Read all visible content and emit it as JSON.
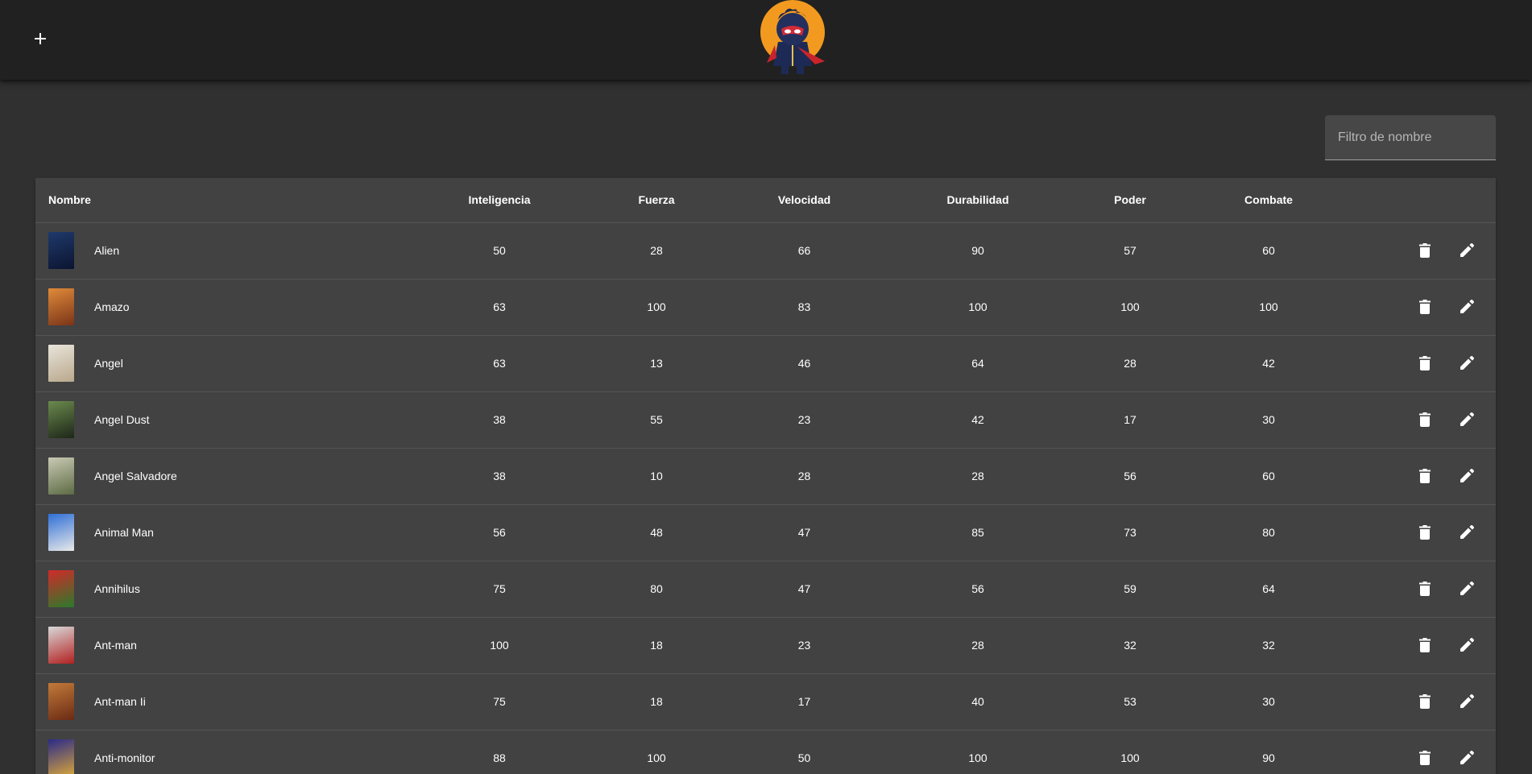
{
  "toolbar": {
    "add_icon": "plus-icon",
    "logo_icon": "superhero-mascot-logo"
  },
  "filter": {
    "placeholder": "Filtro de nombre",
    "value": ""
  },
  "table": {
    "headers": {
      "name": "Nombre",
      "intelligence": "Inteligencia",
      "strength": "Fuerza",
      "speed": "Velocidad",
      "durability": "Durabilidad",
      "power": "Poder",
      "combat": "Combate"
    },
    "row_actions": {
      "delete_icon": "trash-icon",
      "edit_icon": "pencil-icon"
    },
    "rows": [
      {
        "name": "Alien",
        "intelligence": "50",
        "strength": "28",
        "speed": "66",
        "durability": "90",
        "power": "57",
        "combat": "60",
        "thumb_colors": [
          "#1f3a6b",
          "#0b1430"
        ]
      },
      {
        "name": "Amazo",
        "intelligence": "63",
        "strength": "100",
        "speed": "83",
        "durability": "100",
        "power": "100",
        "combat": "100",
        "thumb_colors": [
          "#e08a3a",
          "#7a3418"
        ]
      },
      {
        "name": "Angel",
        "intelligence": "63",
        "strength": "13",
        "speed": "46",
        "durability": "64",
        "power": "28",
        "combat": "42",
        "thumb_colors": [
          "#e8e4da",
          "#b9a88c"
        ]
      },
      {
        "name": "Angel Dust",
        "intelligence": "38",
        "strength": "55",
        "speed": "23",
        "durability": "42",
        "power": "17",
        "combat": "30",
        "thumb_colors": [
          "#6b8a4e",
          "#1d2618"
        ]
      },
      {
        "name": "Angel Salvadore",
        "intelligence": "38",
        "strength": "10",
        "speed": "28",
        "durability": "28",
        "power": "56",
        "combat": "60",
        "thumb_colors": [
          "#c9c9b4",
          "#5d6b44"
        ]
      },
      {
        "name": "Animal Man",
        "intelligence": "56",
        "strength": "48",
        "speed": "47",
        "durability": "85",
        "power": "73",
        "combat": "80",
        "thumb_colors": [
          "#2f6fd6",
          "#e9e9e9"
        ]
      },
      {
        "name": "Annihilus",
        "intelligence": "75",
        "strength": "80",
        "speed": "47",
        "durability": "56",
        "power": "59",
        "combat": "64",
        "thumb_colors": [
          "#d12a2a",
          "#2b7a2b"
        ]
      },
      {
        "name": "Ant-man",
        "intelligence": "100",
        "strength": "18",
        "speed": "23",
        "durability": "28",
        "power": "32",
        "combat": "32",
        "thumb_colors": [
          "#d8d8d8",
          "#b32020"
        ]
      },
      {
        "name": "Ant-man Ii",
        "intelligence": "75",
        "strength": "18",
        "speed": "17",
        "durability": "40",
        "power": "53",
        "combat": "30",
        "thumb_colors": [
          "#c27a3a",
          "#6b2a14"
        ]
      },
      {
        "name": "Anti-monitor",
        "intelligence": "88",
        "strength": "100",
        "speed": "50",
        "durability": "100",
        "power": "100",
        "combat": "90",
        "thumb_colors": [
          "#2a2a8a",
          "#d9a63a"
        ]
      }
    ]
  }
}
